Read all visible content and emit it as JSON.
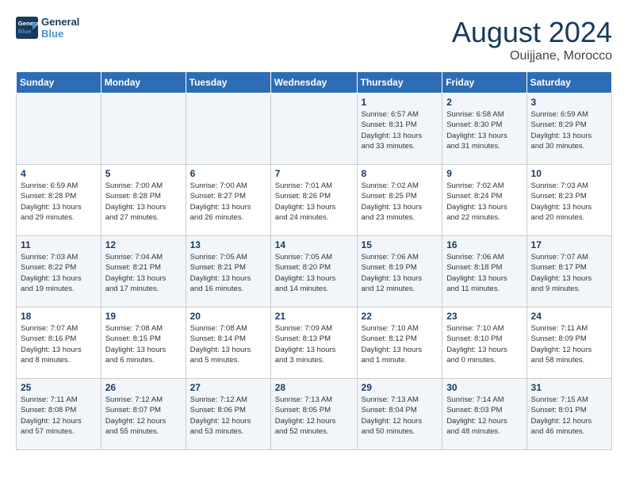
{
  "logo": {
    "line1": "General",
    "line2": "Blue"
  },
  "title": "August 2024",
  "location": "Ouijjane, Morocco",
  "days_of_week": [
    "Sunday",
    "Monday",
    "Tuesday",
    "Wednesday",
    "Thursday",
    "Friday",
    "Saturday"
  ],
  "weeks": [
    [
      {
        "day": "",
        "detail": ""
      },
      {
        "day": "",
        "detail": ""
      },
      {
        "day": "",
        "detail": ""
      },
      {
        "day": "",
        "detail": ""
      },
      {
        "day": "1",
        "detail": "Sunrise: 6:57 AM\nSunset: 8:31 PM\nDaylight: 13 hours\nand 33 minutes."
      },
      {
        "day": "2",
        "detail": "Sunrise: 6:58 AM\nSunset: 8:30 PM\nDaylight: 13 hours\nand 31 minutes."
      },
      {
        "day": "3",
        "detail": "Sunrise: 6:59 AM\nSunset: 8:29 PM\nDaylight: 13 hours\nand 30 minutes."
      }
    ],
    [
      {
        "day": "4",
        "detail": "Sunrise: 6:59 AM\nSunset: 8:28 PM\nDaylight: 13 hours\nand 29 minutes."
      },
      {
        "day": "5",
        "detail": "Sunrise: 7:00 AM\nSunset: 8:28 PM\nDaylight: 13 hours\nand 27 minutes."
      },
      {
        "day": "6",
        "detail": "Sunrise: 7:00 AM\nSunset: 8:27 PM\nDaylight: 13 hours\nand 26 minutes."
      },
      {
        "day": "7",
        "detail": "Sunrise: 7:01 AM\nSunset: 8:26 PM\nDaylight: 13 hours\nand 24 minutes."
      },
      {
        "day": "8",
        "detail": "Sunrise: 7:02 AM\nSunset: 8:25 PM\nDaylight: 13 hours\nand 23 minutes."
      },
      {
        "day": "9",
        "detail": "Sunrise: 7:02 AM\nSunset: 8:24 PM\nDaylight: 13 hours\nand 22 minutes."
      },
      {
        "day": "10",
        "detail": "Sunrise: 7:03 AM\nSunset: 8:23 PM\nDaylight: 13 hours\nand 20 minutes."
      }
    ],
    [
      {
        "day": "11",
        "detail": "Sunrise: 7:03 AM\nSunset: 8:22 PM\nDaylight: 13 hours\nand 19 minutes."
      },
      {
        "day": "12",
        "detail": "Sunrise: 7:04 AM\nSunset: 8:21 PM\nDaylight: 13 hours\nand 17 minutes."
      },
      {
        "day": "13",
        "detail": "Sunrise: 7:05 AM\nSunset: 8:21 PM\nDaylight: 13 hours\nand 16 minutes."
      },
      {
        "day": "14",
        "detail": "Sunrise: 7:05 AM\nSunset: 8:20 PM\nDaylight: 13 hours\nand 14 minutes."
      },
      {
        "day": "15",
        "detail": "Sunrise: 7:06 AM\nSunset: 8:19 PM\nDaylight: 13 hours\nand 12 minutes."
      },
      {
        "day": "16",
        "detail": "Sunrise: 7:06 AM\nSunset: 8:18 PM\nDaylight: 13 hours\nand 11 minutes."
      },
      {
        "day": "17",
        "detail": "Sunrise: 7:07 AM\nSunset: 8:17 PM\nDaylight: 13 hours\nand 9 minutes."
      }
    ],
    [
      {
        "day": "18",
        "detail": "Sunrise: 7:07 AM\nSunset: 8:16 PM\nDaylight: 13 hours\nand 8 minutes."
      },
      {
        "day": "19",
        "detail": "Sunrise: 7:08 AM\nSunset: 8:15 PM\nDaylight: 13 hours\nand 6 minutes."
      },
      {
        "day": "20",
        "detail": "Sunrise: 7:08 AM\nSunset: 8:14 PM\nDaylight: 13 hours\nand 5 minutes."
      },
      {
        "day": "21",
        "detail": "Sunrise: 7:09 AM\nSunset: 8:13 PM\nDaylight: 13 hours\nand 3 minutes."
      },
      {
        "day": "22",
        "detail": "Sunrise: 7:10 AM\nSunset: 8:12 PM\nDaylight: 13 hours\nand 1 minute."
      },
      {
        "day": "23",
        "detail": "Sunrise: 7:10 AM\nSunset: 8:10 PM\nDaylight: 13 hours\nand 0 minutes."
      },
      {
        "day": "24",
        "detail": "Sunrise: 7:11 AM\nSunset: 8:09 PM\nDaylight: 12 hours\nand 58 minutes."
      }
    ],
    [
      {
        "day": "25",
        "detail": "Sunrise: 7:11 AM\nSunset: 8:08 PM\nDaylight: 12 hours\nand 57 minutes."
      },
      {
        "day": "26",
        "detail": "Sunrise: 7:12 AM\nSunset: 8:07 PM\nDaylight: 12 hours\nand 55 minutes."
      },
      {
        "day": "27",
        "detail": "Sunrise: 7:12 AM\nSunset: 8:06 PM\nDaylight: 12 hours\nand 53 minutes."
      },
      {
        "day": "28",
        "detail": "Sunrise: 7:13 AM\nSunset: 8:05 PM\nDaylight: 12 hours\nand 52 minutes."
      },
      {
        "day": "29",
        "detail": "Sunrise: 7:13 AM\nSunset: 8:04 PM\nDaylight: 12 hours\nand 50 minutes."
      },
      {
        "day": "30",
        "detail": "Sunrise: 7:14 AM\nSunset: 8:03 PM\nDaylight: 12 hours\nand 48 minutes."
      },
      {
        "day": "31",
        "detail": "Sunrise: 7:15 AM\nSunset: 8:01 PM\nDaylight: 12 hours\nand 46 minutes."
      }
    ]
  ]
}
